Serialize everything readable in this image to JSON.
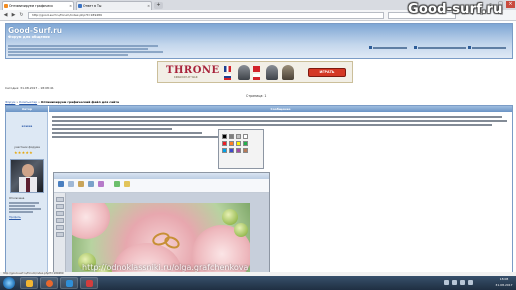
{
  "browser": {
    "tabs": [
      {
        "label": "Оптимизируем графическ"
      },
      {
        "label": "Ответ в Ты"
      }
    ],
    "address": "http://good-surf.ru/forum/index.php?t=189489",
    "icons": [
      "back-icon",
      "forward-icon",
      "reload-icon",
      "home-icon",
      "download-icon",
      "bookmark-icon",
      "menu-icon"
    ]
  },
  "watermark": "Good-surf.ru",
  "forum": {
    "logo": "Good-Surf.ru",
    "slogan": "Форум для общения"
  },
  "ad": {
    "logo": "THRONE",
    "subtitle": "KINGDOM AT WAR",
    "button": "ИГРАТЬ",
    "colors": {
      "button": "#d43825",
      "logo": "#a8233b"
    }
  },
  "datetime": "Сегодня: 31.08.2017 - 18:08:41",
  "pagination": "Страница: 1",
  "breadcrumb": {
    "items": [
      "Форум",
      "Компьютер"
    ],
    "current": "Оптимизируем графический файл для сайта"
  },
  "post": {
    "left_header": "Автор",
    "right_header": "Сообщение",
    "author": "ксюха",
    "rank": "участник форума",
    "stars": "★★★★★",
    "stats_label": "Отключена",
    "profile_link": "Профиль"
  },
  "embedded_image": {
    "watermark_text": "http://odnoklassniki.ru/olga.grafchenkova"
  },
  "statusbar": "http://good-surf.ru/forum/index.php?t=189489",
  "clock": {
    "time": "18:08",
    "date": "31.08.2017"
  }
}
